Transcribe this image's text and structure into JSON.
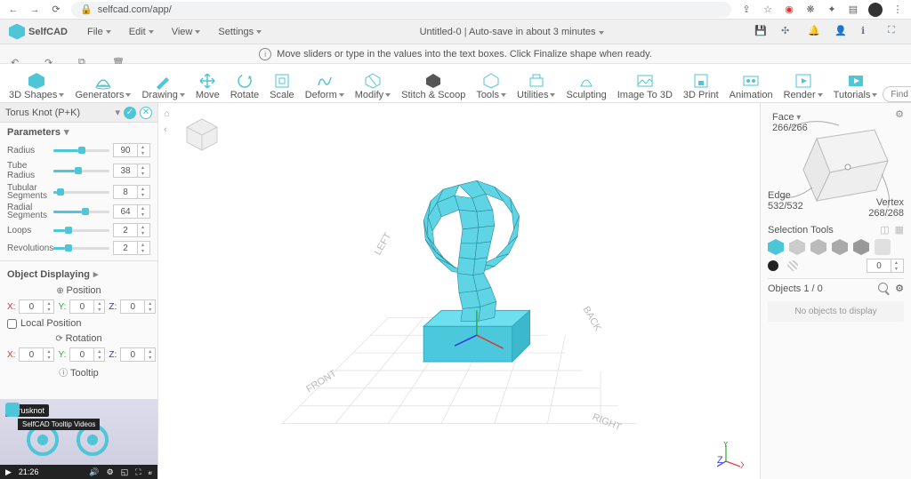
{
  "browser": {
    "url": "selfcad.com/app/"
  },
  "app": {
    "name": "SelfCAD"
  },
  "menu": {
    "file": "File",
    "edit": "Edit",
    "view": "View",
    "settings": "Settings"
  },
  "title": {
    "doc": "Untitled-0",
    "autosave": "Auto-save in about 3 minutes"
  },
  "hint": "Move sliders or type in the values into the text boxes. Click Finalize shape when ready.",
  "ribbon": {
    "shapes": "3D Shapes",
    "generators": "Generators",
    "drawing": "Drawing",
    "move": "Move",
    "rotate": "Rotate",
    "scale": "Scale",
    "deform": "Deform",
    "modify": "Modify",
    "stitch": "Stitch & Scoop",
    "tools": "Tools",
    "utilities": "Utilities",
    "sculpting": "Sculpting",
    "imageto3d": "Image To 3D",
    "print": "3D Print",
    "animation": "Animation",
    "render": "Render",
    "tutorials": "Tutorials",
    "findtool": "Find Tool"
  },
  "panel": {
    "title": "Torus Knot (P+K)",
    "parameters": "Parameters",
    "radius": {
      "label": "Radius",
      "value": "90"
    },
    "tuberadius": {
      "label": "Tube Radius",
      "value": "38"
    },
    "tubseg": {
      "label": "Tubular Segments",
      "value": "8"
    },
    "radseg": {
      "label": "Radial Segments",
      "value": "64"
    },
    "loops": {
      "label": "Loops",
      "value": "2"
    },
    "rev": {
      "label": "Revolutions",
      "value": "2"
    },
    "objdisp": "Object Displaying",
    "position": "Position",
    "rotation": "Rotation",
    "localpos": "Local Position",
    "x": "X:",
    "y": "Y:",
    "z": "Z:",
    "zero": "0",
    "tooltip": "Tooltip"
  },
  "video": {
    "tag": "Torusknot",
    "tag2": "SelfCAD Tooltip Videos",
    "time": "21:26"
  },
  "right": {
    "face": "Face",
    "facecount": "266/266",
    "edge": "Edge",
    "edgecount": "532/532",
    "vertex": "Vertex",
    "vertexcount": "268/268",
    "seltools": "Selection Tools",
    "objects": "Objects 1 / 0",
    "noobjects": "No objects to display",
    "zero": "0"
  },
  "axis": {
    "left": "LEFT",
    "back": "BACK",
    "front": "FRONT",
    "right": "RIGHT",
    "x": "X",
    "y": "Y",
    "z": "Z"
  }
}
